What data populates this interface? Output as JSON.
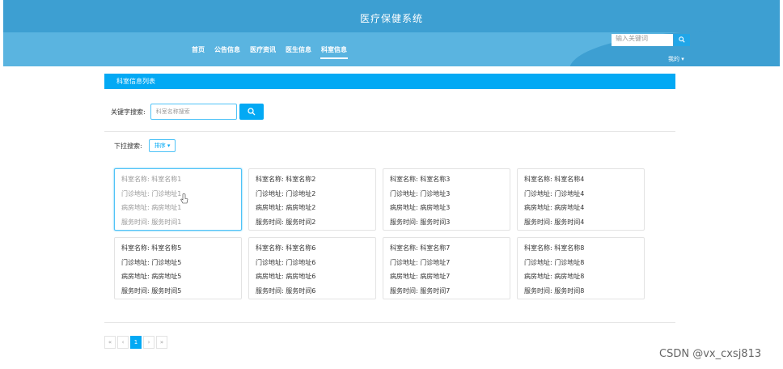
{
  "header": {
    "site_title": "医疗保健系统",
    "nav": [
      "首页",
      "公告信息",
      "医疗资讯",
      "医生信息",
      "科室信息"
    ],
    "active_nav": 4,
    "search_placeholder": "输入关键词",
    "search_icon": "search-icon",
    "user_menu": "我的 ▾"
  },
  "panel": {
    "title": "科室信息列表"
  },
  "search": {
    "label": "关键字搜索:",
    "placeholder": "科室名称搜索",
    "button_icon": "search-icon"
  },
  "filter": {
    "label": "下拉搜索:",
    "sort_label": "排序 ▾"
  },
  "cards": [
    {
      "name": "科室名称: 科室名称1",
      "clinic": "门诊地址: 门诊地址1",
      "ward": "病房地址: 病房地址1",
      "hours": "服务时间: 服务时间1"
    },
    {
      "name": "科室名称: 科室名称2",
      "clinic": "门诊地址: 门诊地址2",
      "ward": "病房地址: 病房地址2",
      "hours": "服务时间: 服务时间2"
    },
    {
      "name": "科室名称: 科室名称3",
      "clinic": "门诊地址: 门诊地址3",
      "ward": "病房地址: 病房地址3",
      "hours": "服务时间: 服务时间3"
    },
    {
      "name": "科室名称: 科室名称4",
      "clinic": "门诊地址: 门诊地址4",
      "ward": "病房地址: 病房地址4",
      "hours": "服务时间: 服务时间4"
    },
    {
      "name": "科室名称: 科室名称5",
      "clinic": "门诊地址: 门诊地址5",
      "ward": "病房地址: 病房地址5",
      "hours": "服务时间: 服务时间5"
    },
    {
      "name": "科室名称: 科室名称6",
      "clinic": "门诊地址: 门诊地址6",
      "ward": "病房地址: 病房地址6",
      "hours": "服务时间: 服务时间6"
    },
    {
      "name": "科室名称: 科室名称7",
      "clinic": "门诊地址: 门诊地址7",
      "ward": "病房地址: 病房地址7",
      "hours": "服务时间: 服务时间7"
    },
    {
      "name": "科室名称: 科室名称8",
      "clinic": "门诊地址: 门诊地址8",
      "ward": "病房地址: 病房地址8",
      "hours": "服务时间: 服务时间8"
    }
  ],
  "pagination": {
    "first": "«",
    "prev": "‹",
    "current": "1",
    "next": "›",
    "last": "»"
  },
  "watermark": "CSDN @vx_cxsj813",
  "colors": {
    "header_blue": "#3d9fd2",
    "accent": "#03a9f4"
  }
}
